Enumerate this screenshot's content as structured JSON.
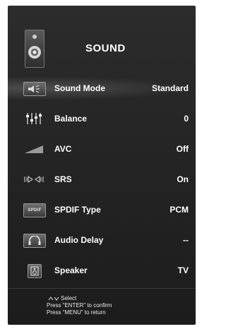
{
  "menu": {
    "title": "SOUND",
    "items": [
      {
        "label": "Sound Mode",
        "value": "Standard",
        "icon": "speaker-mode-icon"
      },
      {
        "label": "Balance",
        "value": "0",
        "icon": "balance-sliders-icon"
      },
      {
        "label": "AVC",
        "value": "Off",
        "icon": "volume-ramp-icon"
      },
      {
        "label": "SRS",
        "value": "On",
        "icon": "srs-icon"
      },
      {
        "label": "SPDIF Type",
        "value": "PCM",
        "icon": "spdif-icon"
      },
      {
        "label": "Audio Delay",
        "value": "--",
        "icon": "headphones-icon"
      },
      {
        "label": "Speaker",
        "value": "TV",
        "icon": "speaker-icon"
      }
    ],
    "selected_index": 0
  },
  "footer": {
    "select": "Select",
    "confirm": "Press “ENTER” to confirm",
    "return": "Press “MENU” to return"
  },
  "icons": {
    "spdif_text": "SPDIF"
  }
}
